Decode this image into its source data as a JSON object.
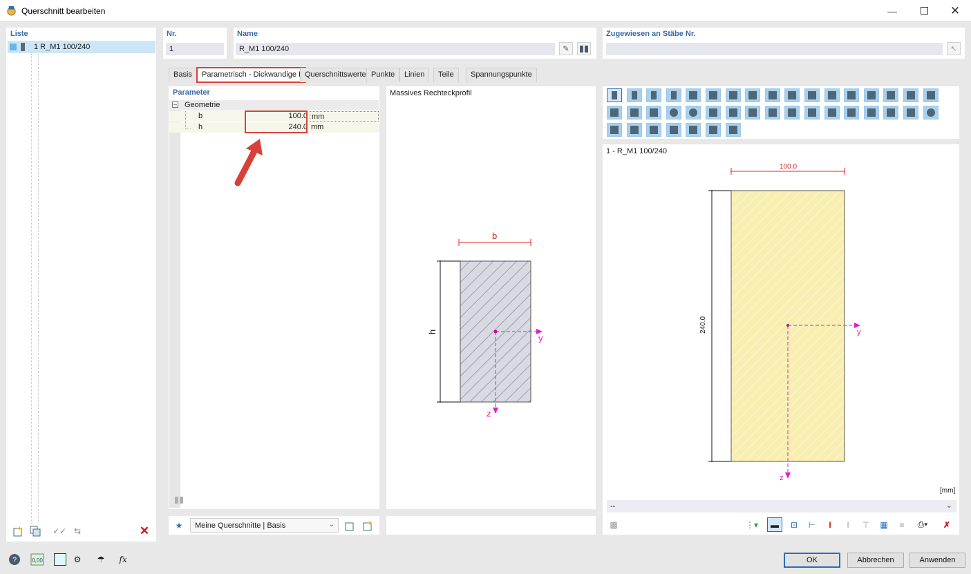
{
  "window": {
    "title": "Querschnitt bearbeiten"
  },
  "list": {
    "header": "Liste",
    "items": [
      {
        "label": "1 R_M1 100/240"
      }
    ]
  },
  "nr": {
    "label": "Nr.",
    "value": "1"
  },
  "name": {
    "label": "Name",
    "value": "R_M1 100/240"
  },
  "assigned": {
    "label": "Zugewiesen an Stäbe Nr.",
    "value": ""
  },
  "tabs": [
    {
      "label": "Basis"
    },
    {
      "label": "Parametrisch - Dickwandige I"
    },
    {
      "label": "Querschnittswerte"
    },
    {
      "label": "Punkte"
    },
    {
      "label": "Linien"
    },
    {
      "label": "Teile"
    },
    {
      "label": "Spannungspunkte"
    }
  ],
  "parameters": {
    "header": "Parameter",
    "group": "Geometrie",
    "rows": [
      {
        "name": "b",
        "value": "100.0",
        "unit": "mm"
      },
      {
        "name": "h",
        "value": "240.0",
        "unit": "mm"
      }
    ]
  },
  "schematic": {
    "title": "Massives Rechteckprofil",
    "label_b": "b",
    "label_h": "h",
    "label_y": "y",
    "label_z": "z"
  },
  "preview": {
    "title": "1 - R_M1 100/240",
    "dim_width": "100.0",
    "dim_height": "240.0",
    "label_y": "y",
    "label_z": "z",
    "unit": "[mm]",
    "dropdown": "--"
  },
  "library": {
    "dropdown": "Meine Querschnitte | Basis"
  },
  "buttons": {
    "ok": "OK",
    "cancel": "Abbrechen",
    "apply": "Anwenden"
  },
  "colors": {
    "accent_red": "#d9403b",
    "header_blue": "#3a6aa6",
    "icon_blue": "#a9d1ee",
    "dim_red": "#e8232a",
    "axis_magenta": "#e020c0",
    "section_fill": "#f7eeb0"
  }
}
